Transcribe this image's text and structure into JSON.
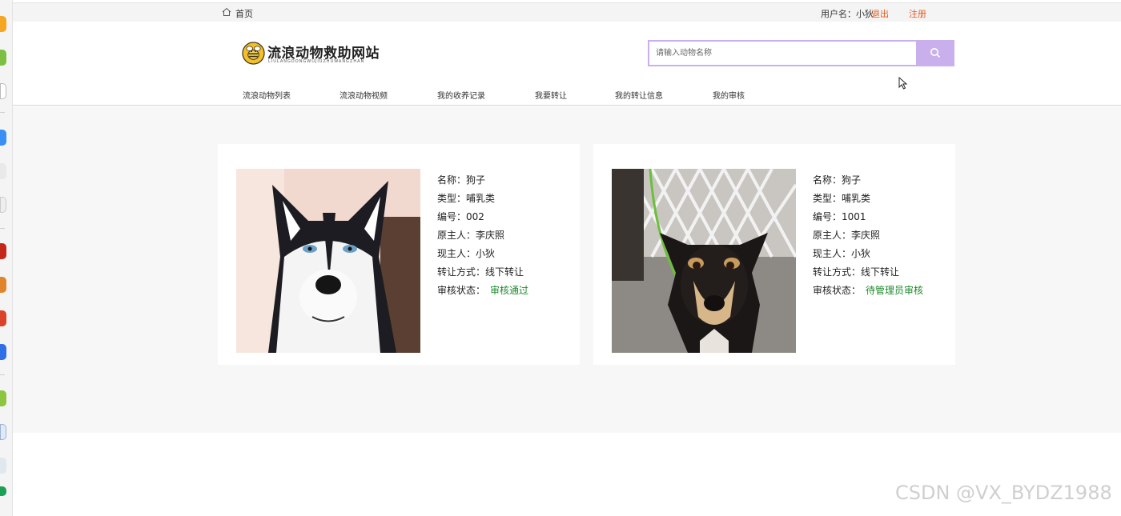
{
  "topbar": {
    "home_label": "首页",
    "username_label": "用户名：小狄",
    "logout_label": "退出",
    "register_label": "注册"
  },
  "header": {
    "site_title": "流浪动物救助网站",
    "site_subtitle": "LIULANGDONGWUJIUZHUWANGZHAN",
    "search": {
      "placeholder": "请输入动物名称",
      "value": ""
    }
  },
  "nav": {
    "items": [
      {
        "label": "流浪动物列表"
      },
      {
        "label": "流浪动物视频"
      },
      {
        "label": "我的收养记录"
      },
      {
        "label": "我要转让"
      },
      {
        "label": "我的转让信息"
      },
      {
        "label": "我的审核"
      }
    ]
  },
  "cards": [
    {
      "name": "名称：狗子",
      "type": "类型：哺乳类",
      "code": "编号：002",
      "original_owner": "原主人：李庆照",
      "current_owner": "现主人：小狄",
      "transfer_method": "转让方式：线下转让",
      "status_label": "审核状态：",
      "status_value": "审核通过"
    },
    {
      "name": "名称：狗子",
      "type": "类型：哺乳类",
      "code": "编号：1001",
      "original_owner": "原主人：李庆照",
      "current_owner": "现主人：小狄",
      "transfer_method": "转让方式：线下转让",
      "status_label": "审核状态：",
      "status_value": "待管理员审核"
    }
  ],
  "watermark": "CSDN @VX_BYDZ1988",
  "colors": {
    "accent": "#c9b0ec",
    "link": "#e35b1f",
    "status": "#1c8a2b",
    "content_bg": "#f7f7f7"
  }
}
